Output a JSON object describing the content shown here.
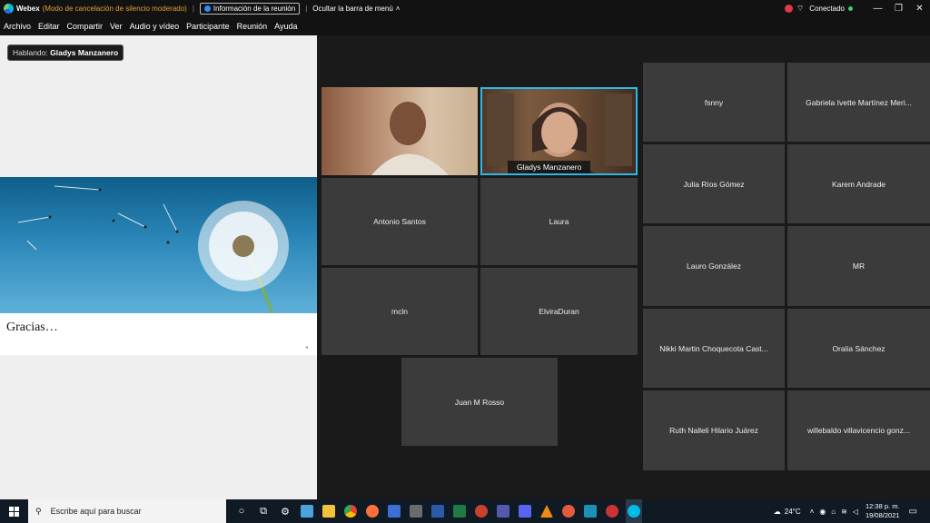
{
  "titlebar": {
    "app_name": "Webex",
    "mode": "(Modo de cancelación de silencio moderado)",
    "meeting_info_label": "Información de la reunión",
    "hide_menu_label": "Ocultar la barra de menú",
    "status": "Conectado"
  },
  "menu": {
    "items": [
      "Archivo",
      "Editar",
      "Compartir",
      "Ver",
      "Audio y vídeo",
      "Participante",
      "Reunión",
      "Ayuda"
    ]
  },
  "share": {
    "speaking_prefix": "Hablando:",
    "speaker_name": "Gladys Manzanero",
    "slide_text": "Gracias…"
  },
  "video": {
    "active_name": "Gladys Manzanero"
  },
  "center_grid": [
    "Antonio Santos",
    "Laura",
    "mcln",
    "ElviraDuran",
    "Juan M Rosso"
  ],
  "right_grid": [
    "fsnny",
    "Gabriela Ivette Martínez Meri...",
    "Julia Ríos Gómez",
    "Karem Andrade",
    "Lauro González",
    "MR",
    "Nikki Martin Choquecota Cast...",
    "Oralia Sánchez",
    "Ruth Nalleli Hilario Juárez",
    "willebaldo villavicencio gonz..."
  ],
  "taskbar": {
    "search_placeholder": "Escribe aquí para buscar",
    "temperature": "24°C",
    "time": "12:38 p. m.",
    "date": "19/08/2021"
  },
  "colors": {
    "accent": "#2fb7e8",
    "mode_text": "#e3a02f",
    "tile_bg": "#3b3b3b"
  }
}
